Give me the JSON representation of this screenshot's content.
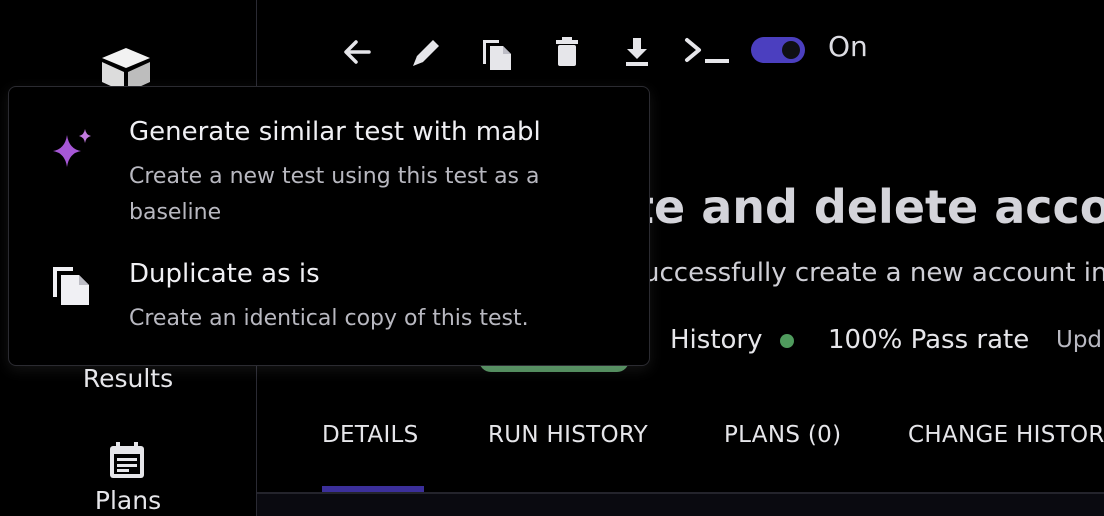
{
  "toolbar": {
    "icons": [
      "back-arrow-icon",
      "edit-pencil-icon",
      "copy-icon",
      "delete-icon",
      "download-icon",
      "terminal-icon"
    ],
    "toggle_state": "On"
  },
  "sidebar": {
    "items": [
      {
        "label": "Results"
      },
      {
        "label": "Plans"
      }
    ]
  },
  "test": {
    "title": "te and delete accou",
    "subtitle": "uccessfully create a new account in",
    "history_label": "History",
    "pass_rate": "100% Pass rate",
    "updated": "Upd"
  },
  "tabs": [
    {
      "label": "DETAILS",
      "active": true
    },
    {
      "label": "RUN HISTORY"
    },
    {
      "label": "PLANS (0)"
    },
    {
      "label": "CHANGE HISTOR"
    }
  ],
  "menu": {
    "items": [
      {
        "icon": "sparkle-ai-icon",
        "label": "Generate similar test with mabl",
        "description_line1": "Create a new test using this test as a",
        "description_line2": "baseline"
      },
      {
        "icon": "copy-icon",
        "label": "Duplicate as is",
        "description_line1": "Create an identical copy of this test."
      }
    ]
  },
  "colors": {
    "background": "#000000",
    "accent": "#4b3fbf",
    "success": "#4f9b5d",
    "sparkle": "#b45fd8"
  }
}
